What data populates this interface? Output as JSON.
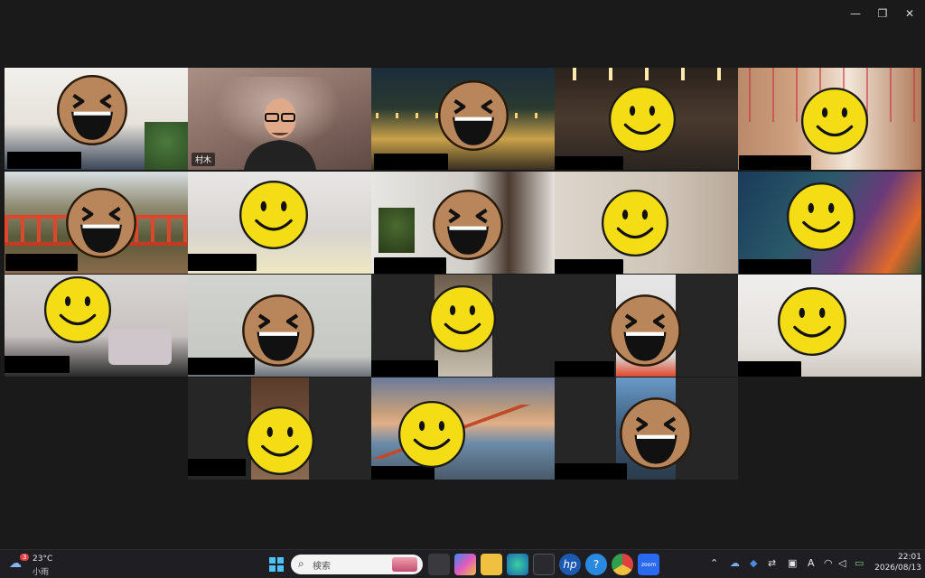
{
  "window": {
    "minimize_icon": "minimize-icon",
    "restore_icon": "restore-icon",
    "close_icon": "close-icon",
    "minimize_glyph": "—",
    "restore_glyph": "❐",
    "close_glyph": "✕"
  },
  "meeting": {
    "active_speaker_name": "村木",
    "tiles": [
      {
        "id": "tile-1",
        "face": "laugh",
        "scene": "white-room"
      },
      {
        "id": "tile-2",
        "face": "none",
        "scene": "speaker"
      },
      {
        "id": "tile-3",
        "face": "laugh",
        "scene": "city-night"
      },
      {
        "id": "tile-4",
        "face": "smile",
        "scene": "dark-room"
      },
      {
        "id": "tile-5",
        "face": "smile",
        "scene": "decor"
      },
      {
        "id": "tile-6",
        "face": "laugh",
        "scene": "red-bridge"
      },
      {
        "id": "tile-7",
        "face": "smile",
        "scene": "light-room"
      },
      {
        "id": "tile-8",
        "face": "laugh",
        "scene": "plants-room"
      },
      {
        "id": "tile-9",
        "face": "smile",
        "scene": "beige-room"
      },
      {
        "id": "tile-10",
        "face": "smile",
        "scene": "fire-art"
      },
      {
        "id": "tile-11",
        "face": "smile",
        "scene": "bedroom"
      },
      {
        "id": "tile-12",
        "face": "laugh",
        "scene": "grey-wall"
      },
      {
        "id": "tile-13",
        "face": "smile",
        "scene": "portrait-dark"
      },
      {
        "id": "tile-14",
        "face": "laugh",
        "scene": "portrait-red"
      },
      {
        "id": "tile-15",
        "face": "smile",
        "scene": "white-wall"
      },
      {
        "id": "tile-16",
        "face": "smile",
        "scene": "portrait-door"
      },
      {
        "id": "tile-17",
        "face": "smile",
        "scene": "golden-gate"
      },
      {
        "id": "tile-18",
        "face": "laugh",
        "scene": "portrait-sky"
      }
    ]
  },
  "taskbar": {
    "weather_temp": "23°C",
    "weather_desc": "小雨",
    "weather_badge": "3",
    "search_placeholder": "検索",
    "time": "22:01",
    "date": "2026/08/13",
    "ime_label": "A",
    "zoom_label": "zoom"
  },
  "colors": {
    "background": "#1a1a1a",
    "active_outline": "#2ecc71",
    "smile_yellow": "#f5dd16",
    "laugh_tan": "#b8865a"
  }
}
